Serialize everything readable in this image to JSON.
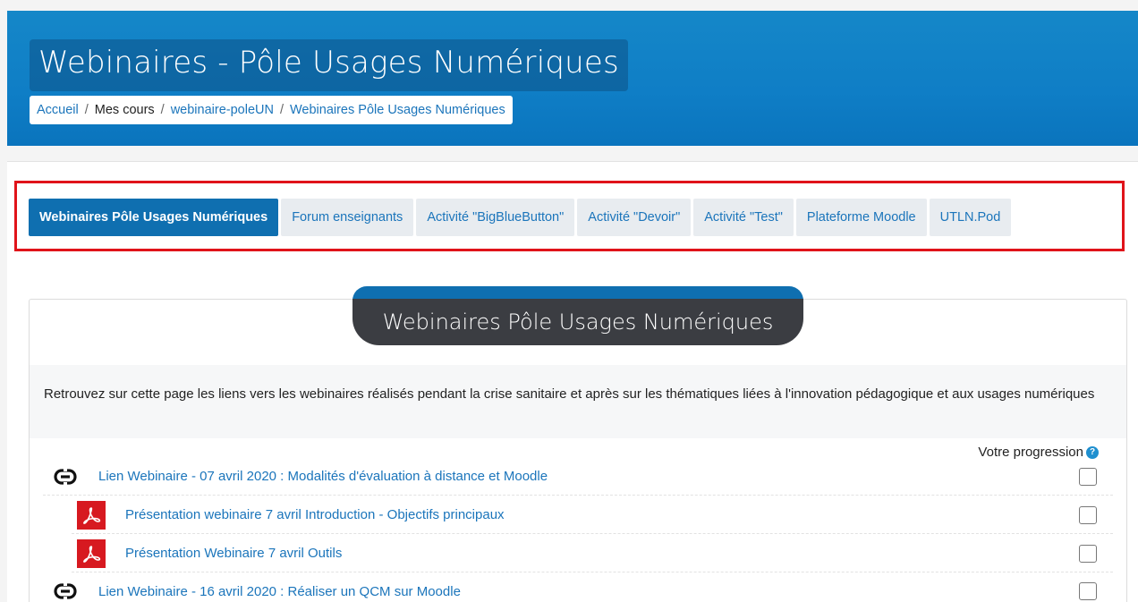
{
  "header": {
    "title": "Webinaires - Pôle Usages Numériques",
    "breadcrumb": [
      {
        "label": "Accueil",
        "link": true
      },
      {
        "label": "Mes cours",
        "link": false
      },
      {
        "label": "webinaire-poleUN",
        "link": true
      },
      {
        "label": "Webinaires Pôle Usages Numériques",
        "link": true
      }
    ],
    "breadcrumb_separator": "/"
  },
  "tabs": [
    {
      "label": "Webinaires Pôle Usages Numériques",
      "active": true
    },
    {
      "label": "Forum enseignants",
      "active": false
    },
    {
      "label": "Activité \"BigBlueButton\"",
      "active": false
    },
    {
      "label": "Activité \"Devoir\"",
      "active": false
    },
    {
      "label": "Activité \"Test\"",
      "active": false
    },
    {
      "label": "Plateforme Moodle",
      "active": false
    },
    {
      "label": "UTLN.Pod",
      "active": false
    }
  ],
  "section": {
    "title": "Webinaires Pôle Usages Numériques",
    "summary": "Retrouvez sur cette page les liens vers les webinaires réalisés pendant la crise sanitaire et après sur les thématiques liées à l'innovation pédagogique et aux usages numériques",
    "progress_label": "Votre progression",
    "help_icon_glyph": "?"
  },
  "activities": [
    {
      "icon": "link-icon",
      "label": "Lien Webinaire - 07 avril 2020 : Modalités d'évaluation à distance et Moodle",
      "completed": false
    },
    {
      "icon": "pdf-icon",
      "label": "Présentation webinaire 7 avril Introduction - Objectifs principaux",
      "completed": false
    },
    {
      "icon": "pdf-icon",
      "label": "Présentation Webinaire 7 avril Outils",
      "completed": false
    },
    {
      "icon": "link-icon",
      "label": "Lien Webinaire - 16 avril 2020 : Réaliser un QCM sur Moodle",
      "completed": false
    }
  ],
  "colors": {
    "banner": "#0f7ec6",
    "active_tab": "#0f6fb0",
    "link": "#1b75bb",
    "highlight_border": "#e0131a",
    "pdf_red": "#d71920"
  }
}
